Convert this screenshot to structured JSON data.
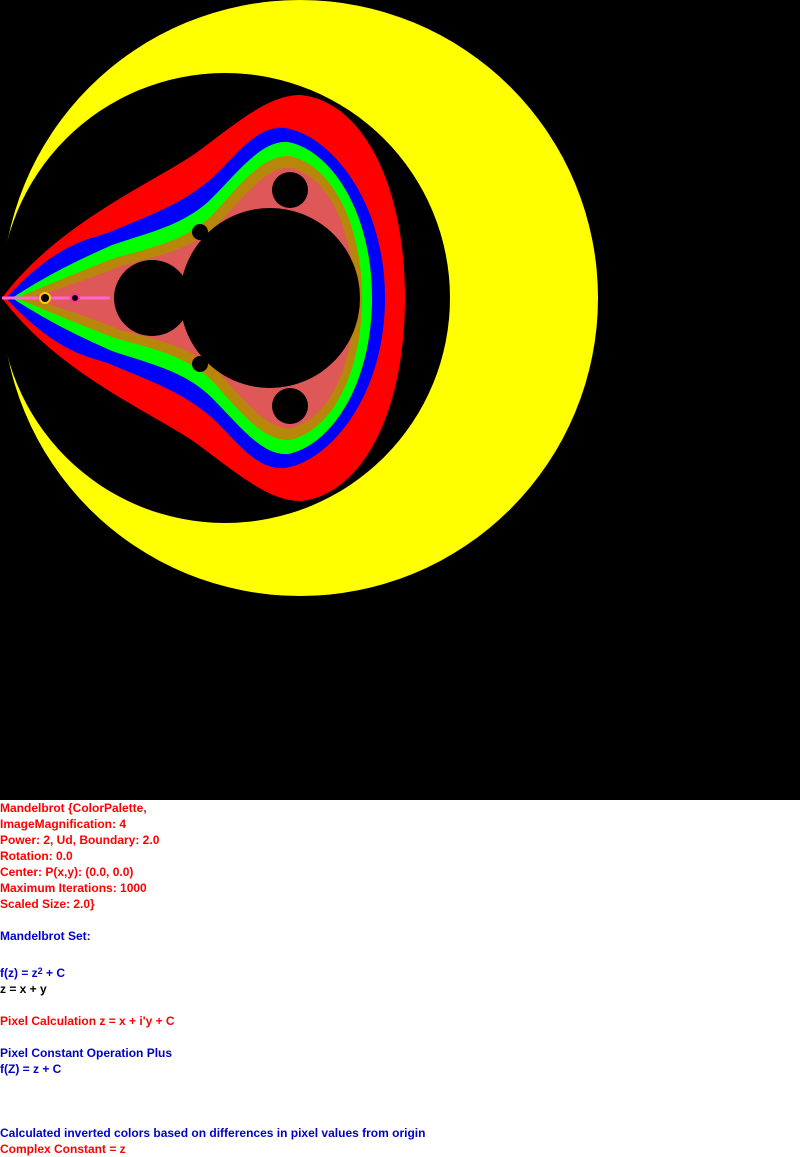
{
  "image": {
    "subject": "Mandelbrot set fractal rendering",
    "background_color": "#000000",
    "palette": [
      "#ffff00",
      "#ff0000",
      "#0000ff",
      "#00ff00"
    ]
  },
  "info": {
    "params": [
      "Mandelbrot {ColorPalette,",
      "ImageMagnification: 4",
      "Power: 2, Ud, Boundary: 2.0",
      "Rotation: 0.0",
      "Center: P(x,y): (0.0, 0.0)",
      "Maximum Iterations: 1000",
      "Scaled Size: 2.0}"
    ],
    "set_title": "Mandelbrot Set:",
    "formula_lhs": "f(z) = z",
    "formula_exp": "2",
    "formula_rhs": " + C",
    "z_def": "z = x + y",
    "pixel_calc": "Pixel Calculation z = x + i'y + C",
    "pixel_const_op": "Pixel Constant Operation Plus",
    "fZ": "f(Z) = z + C",
    "inverted_colors": "Calculated inverted colors based on differences in pixel values from origin",
    "complex_constant": "Complex Constant = z"
  }
}
